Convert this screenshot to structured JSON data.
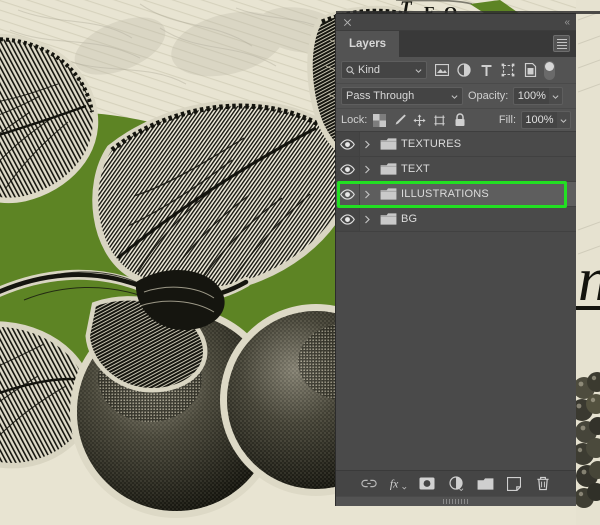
{
  "app": {
    "panel_title": "Layers",
    "close_label": "×",
    "collapse_label": "«",
    "menu_label": "panel-menu"
  },
  "filter": {
    "kind_label": "Kind",
    "icons": [
      {
        "name": "pixel-layer-filter-icon",
        "title": "Filter for pixel layers"
      },
      {
        "name": "adjustment-layer-filter-icon",
        "title": "Filter for adjustment layers"
      },
      {
        "name": "type-layer-filter-icon",
        "title": "Filter for type layers"
      },
      {
        "name": "shape-layer-filter-icon",
        "title": "Filter for shape layers"
      },
      {
        "name": "smart-object-filter-icon",
        "title": "Filter for smart objects"
      }
    ],
    "toggle_name": "filter-enable-toggle"
  },
  "blend": {
    "mode": "Pass Through",
    "opacity_label": "Opacity:",
    "opacity_value": "100%",
    "fill_label": "Fill:",
    "fill_value": "100%"
  },
  "lock": {
    "label": "Lock:",
    "icons": [
      {
        "name": "lock-transparent-pixels-icon"
      },
      {
        "name": "lock-image-pixels-icon"
      },
      {
        "name": "lock-position-icon"
      },
      {
        "name": "lock-artboard-nesting-icon"
      },
      {
        "name": "lock-all-icon"
      }
    ]
  },
  "layers": [
    {
      "name": "TEXTURES",
      "visible": true,
      "type": "group",
      "selected": false,
      "expanded": false
    },
    {
      "name": "TEXT",
      "visible": true,
      "type": "group",
      "selected": false,
      "expanded": false
    },
    {
      "name": "ILLUSTRATIONS",
      "visible": true,
      "type": "group",
      "selected": true,
      "expanded": false
    },
    {
      "name": "BG",
      "visible": true,
      "type": "group",
      "selected": false,
      "expanded": false
    }
  ],
  "bottom_toolbar": [
    {
      "name": "link-layers-icon",
      "label": "Link layers"
    },
    {
      "name": "layer-style-fx-icon",
      "label": "Add a layer style"
    },
    {
      "name": "add-layer-mask-icon",
      "label": "Add layer mask"
    },
    {
      "name": "new-adjustment-layer-icon",
      "label": "Create new fill or adjustment layer"
    },
    {
      "name": "new-group-icon",
      "label": "Create a new group"
    },
    {
      "name": "new-layer-icon",
      "label": "Create a new layer"
    },
    {
      "name": "delete-layer-icon",
      "label": "Delete layer"
    }
  ],
  "colors": {
    "panel_bg": "#535353",
    "list_bg": "#4a4a4a",
    "row_selected": "#5e5e5e",
    "highlight_green": "#22e022",
    "text": "#d8d8d8",
    "artwork_green": "#5d8424",
    "artwork_cream": "#e8e4d2",
    "artwork_ink": "#1a1a16"
  },
  "artwork": {
    "description": "Vintage engraved botanical illustration of leaves and fruit",
    "script_letter": "n"
  }
}
